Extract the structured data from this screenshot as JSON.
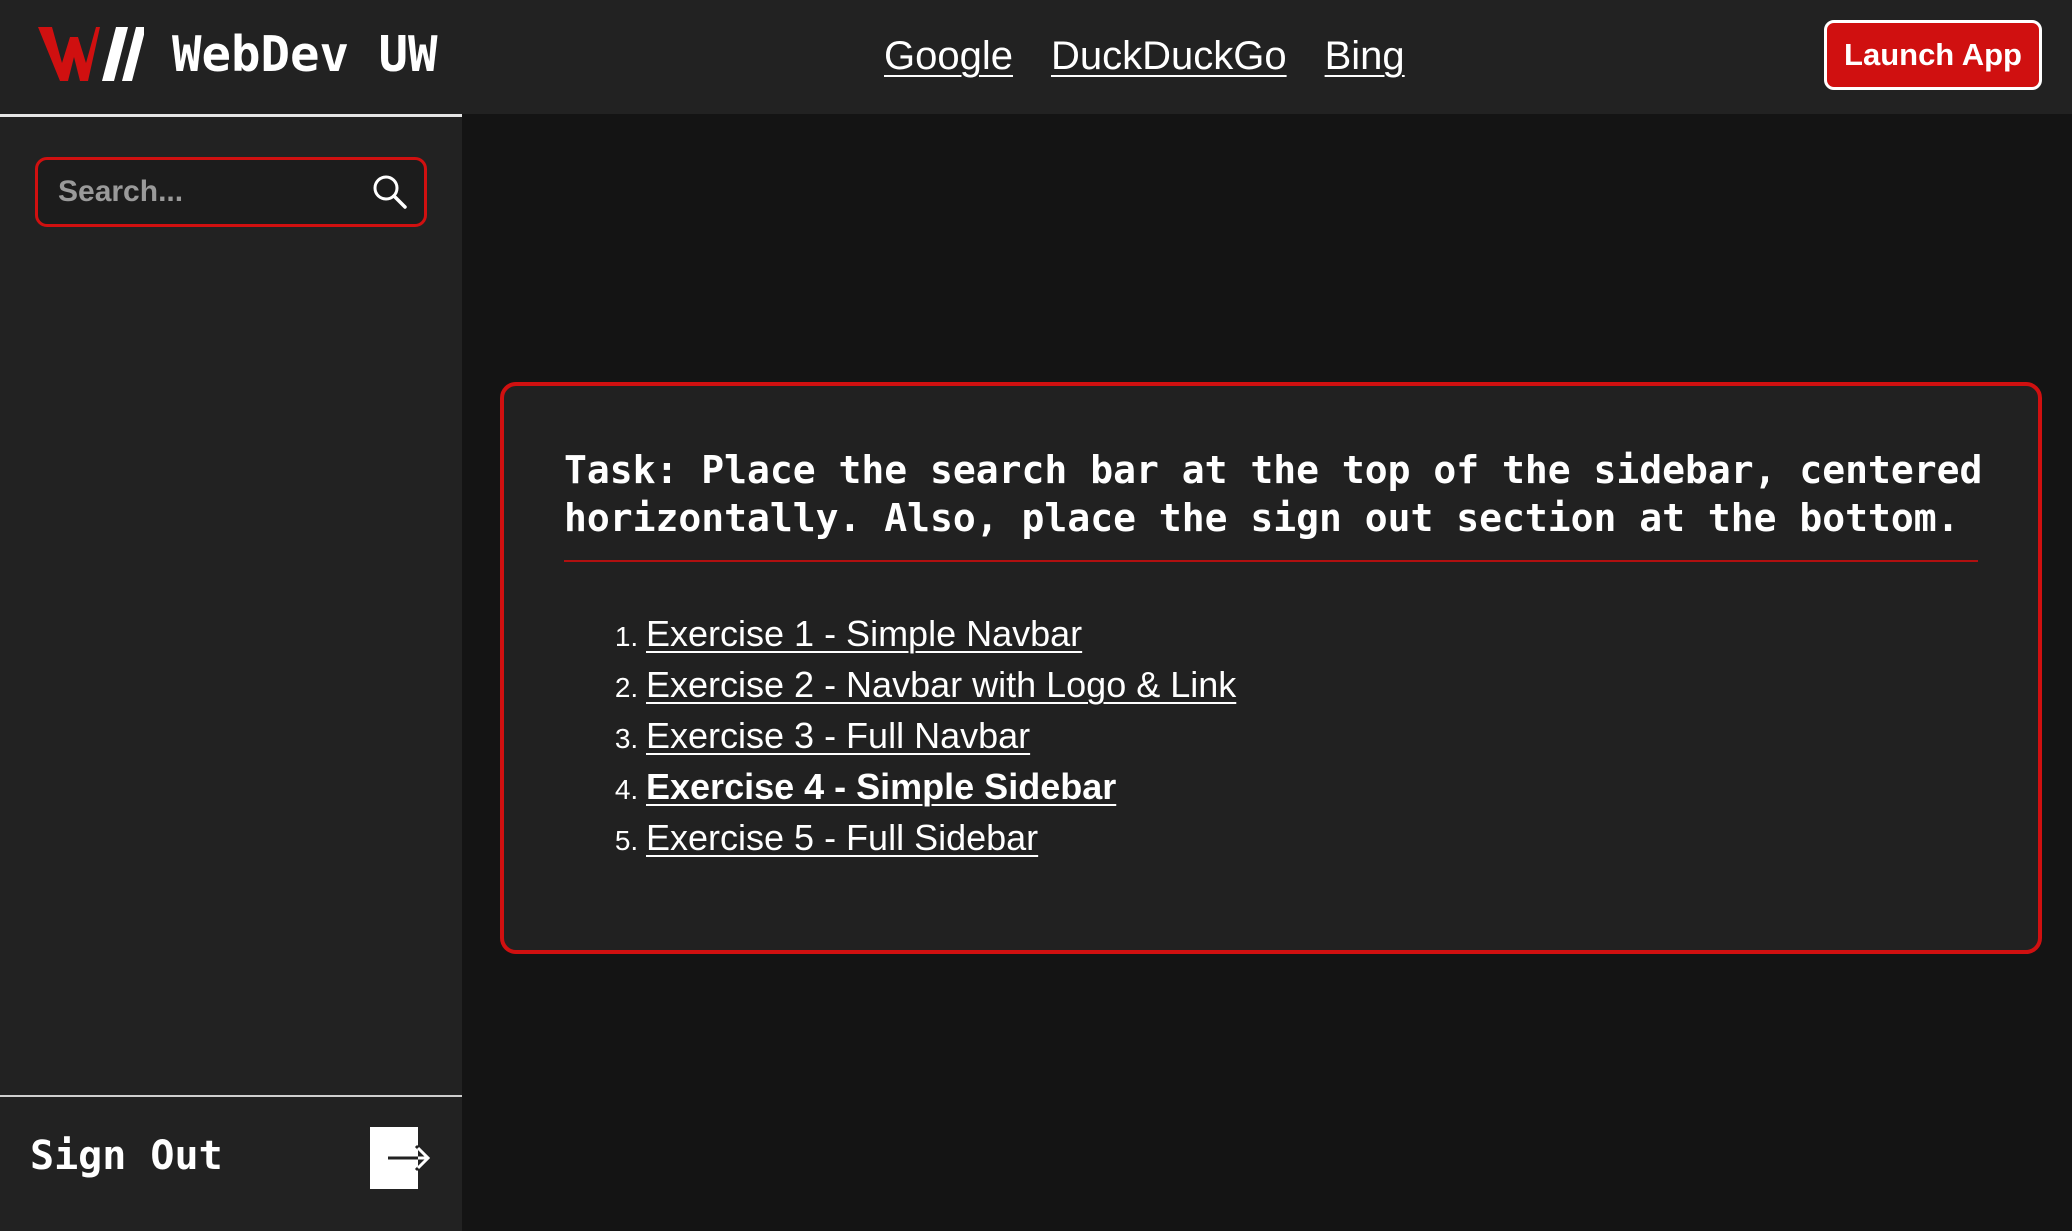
{
  "navbar": {
    "brand_name": "WebDev UW",
    "links": [
      "Google",
      "DuckDuckGo",
      "Bing"
    ],
    "launch_button_label": "Launch App"
  },
  "sidebar": {
    "search": {
      "placeholder": "Search...",
      "value": ""
    },
    "signout_label": "Sign Out"
  },
  "task": {
    "text": "Task: Place the search bar at the top of the sidebar, centered horizontally. Also, place the sign out section at the bottom.",
    "exercises": [
      "Exercise 1 - Simple Navbar",
      "Exercise 2 - Navbar with Logo & Link",
      "Exercise 3 - Full Navbar",
      "Exercise 4 - Simple Sidebar",
      "Exercise 5 - Full Sidebar"
    ],
    "active_exercise_index": 3
  },
  "colors": {
    "accent": "#d01010",
    "panel": "#222222",
    "background": "#141414",
    "text": "#ffffff"
  },
  "icons": [
    "webdev-logo-icon",
    "search-icon",
    "sign-out-arrow-icon"
  ]
}
